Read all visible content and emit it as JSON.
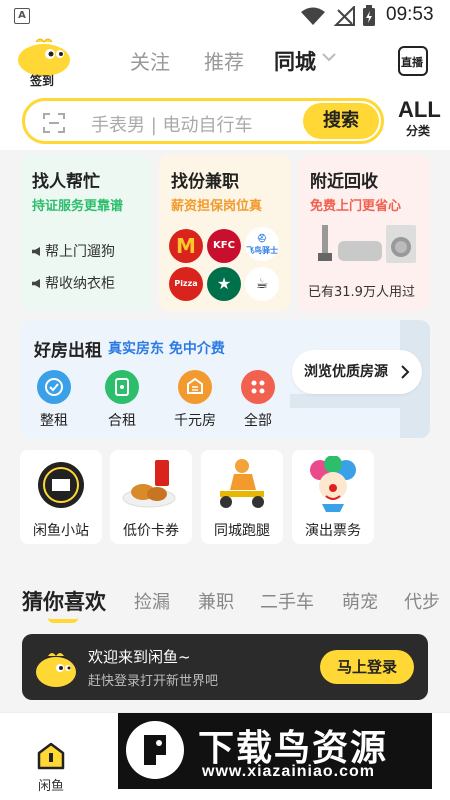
{
  "status": {
    "time": "09:53",
    "a_badge": "A"
  },
  "header": {
    "checkin_label": "签到",
    "tabs": [
      {
        "label": "关注",
        "active": false
      },
      {
        "label": "推荐",
        "active": false
      },
      {
        "label": "同城",
        "active": true
      }
    ],
    "broadcast_label": "直播",
    "search_placeholder": "手表男 | 电动自行车",
    "search_button": "搜索",
    "all_label": "ALL",
    "all_sub": "分类"
  },
  "cards": {
    "help": {
      "title": "找人帮忙",
      "subtitle": "持证服务更靠谱",
      "items": [
        "帮上门遛狗",
        "帮收纳衣柜"
      ]
    },
    "parttime": {
      "title": "找份兼职",
      "subtitle": "薪资担保岗位真",
      "logos": [
        "McDonald's",
        "KFC",
        "飞鸟驿士",
        "Pizza Hut",
        "Starbucks",
        "Hey"
      ]
    },
    "recycle": {
      "title": "附近回收",
      "subtitle": "免费上门更省心",
      "users": "已有31.9万人用过"
    }
  },
  "rent": {
    "title": "好房出租",
    "subtitle": "真实房东 免中介费",
    "items": [
      {
        "label": "整租",
        "color": "#3aa0e8"
      },
      {
        "label": "合租",
        "color": "#2dbe6c"
      },
      {
        "label": "千元房",
        "color": "#f29a2e"
      },
      {
        "label": "全部",
        "color": "#f2604f"
      }
    ],
    "browse_button": "浏览优质房源"
  },
  "services": [
    {
      "label": "闲鱼小站"
    },
    {
      "label": "低价卡券"
    },
    {
      "label": "同城跑腿"
    },
    {
      "label": "演出票务"
    }
  ],
  "guess_tabs": [
    {
      "label": "猜你喜欢",
      "active": true
    },
    {
      "label": "捡漏",
      "active": false
    },
    {
      "label": "兼职",
      "active": false
    },
    {
      "label": "二手车",
      "active": false
    },
    {
      "label": "萌宠",
      "active": false
    },
    {
      "label": "代步",
      "active": false
    }
  ],
  "login": {
    "title": "欢迎来到闲鱼~",
    "subtitle": "赶快登录打开新世界吧",
    "button": "马上登录"
  },
  "bottom_nav": [
    {
      "label": "闲鱼",
      "active": true
    }
  ],
  "watermark": {
    "title": "下载鸟资源",
    "url": "www.xiazainiao.com"
  },
  "colors": {
    "accent": "#ffd835",
    "green": "#2dbe6c",
    "orange": "#f29a2e",
    "red": "#f2604f",
    "blue": "#2c7be5"
  }
}
